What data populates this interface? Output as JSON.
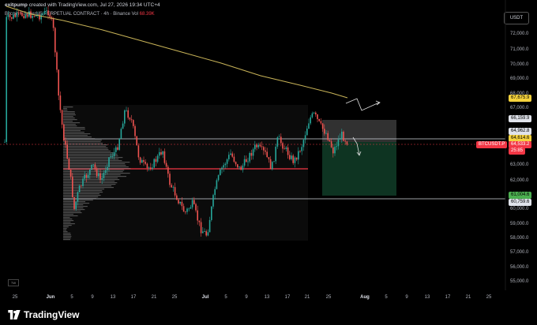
{
  "header": {
    "author": "exitpump",
    "created_text": "created with TradingView.com, Jul 27, 2026 19:34 UTC+4",
    "symbol_text": "Bitcoin / TetherUS PERPETUAL CONTRACT · 4h · Binance",
    "volume_label": "Vol",
    "volume_value": "68.39K",
    "currency": "USDT"
  },
  "price_axis": {
    "labels": [
      "72,000.0",
      "71,000.0",
      "70,000.0",
      "69,000.0",
      "68,000.0",
      "67,000.0",
      "63,000.0",
      "62,000.0",
      "60,000.0",
      "59,000.0",
      "58,000.0",
      "57,000.0",
      "56,000.0",
      "55,000.0"
    ]
  },
  "price_tags": {
    "ma": "67,675.9",
    "top_box": "66,159.9",
    "level_1": "64,962.8",
    "level_2": "64,614.6",
    "current_symbol": "BTCUSDT.P",
    "current_price": "64,533.2",
    "countdown": "25:85",
    "bottom_box": "61,004.6",
    "level_3": "60,759.6"
  },
  "time_axis": {
    "labels": [
      "25",
      "Jun",
      "5",
      "9",
      "13",
      "17",
      "21",
      "25",
      "Jul",
      "5",
      "9",
      "13",
      "17",
      "21",
      "25",
      "Aug",
      "5",
      "9",
      "13",
      "17",
      "21",
      "25"
    ],
    "major": [
      "Jun",
      "Jul",
      "Aug"
    ]
  },
  "footer": {
    "brand": "TradingView",
    "corner_badge": "TW"
  },
  "colors": {
    "up": "#26a69a",
    "down": "#ef5350",
    "ma": "#c9b458",
    "red_line": "#f23645",
    "tag_green": "#4caf50",
    "tag_yellow": "#f5d23d"
  }
}
